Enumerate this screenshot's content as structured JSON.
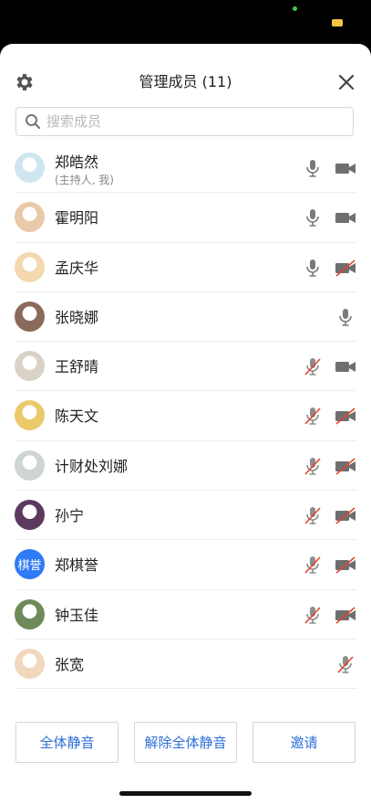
{
  "header": {
    "title": "管理成员 (11)"
  },
  "search": {
    "placeholder": "搜索成员",
    "value": ""
  },
  "members": [
    {
      "name": "郑皓然",
      "sub": "(主持人, 我)",
      "mic": "on",
      "cam": "on"
    },
    {
      "name": "霍明阳",
      "sub": "",
      "mic": "on",
      "cam": "on"
    },
    {
      "name": "孟庆华",
      "sub": "",
      "mic": "on",
      "cam": "off"
    },
    {
      "name": "张晓娜",
      "sub": "",
      "mic": "on",
      "cam": "none"
    },
    {
      "name": "王舒晴",
      "sub": "",
      "mic": "off",
      "cam": "on"
    },
    {
      "name": "陈天文",
      "sub": "",
      "mic": "off",
      "cam": "off"
    },
    {
      "name": "计财处刘娜",
      "sub": "",
      "mic": "off",
      "cam": "off"
    },
    {
      "name": "孙宁",
      "sub": "",
      "mic": "off",
      "cam": "off"
    },
    {
      "name": "郑棋誉",
      "sub": "",
      "mic": "off",
      "cam": "off",
      "avatar_text": "棋誉"
    },
    {
      "name": "钟玉佳",
      "sub": "",
      "mic": "off",
      "cam": "off"
    },
    {
      "name": "张宽",
      "sub": "",
      "mic": "off",
      "cam": "none"
    }
  ],
  "footer": {
    "mute_all": "全体静音",
    "unmute_all": "解除全体静音",
    "invite": "邀请"
  },
  "colors": {
    "accent": "#2d6fd8",
    "mute_red": "#e0452e",
    "icon_gray": "#7a7a7a"
  }
}
